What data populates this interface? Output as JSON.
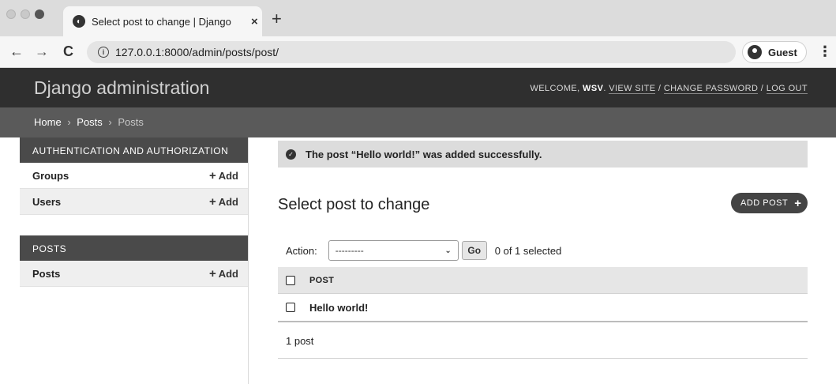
{
  "browser": {
    "tab_title": "Select post to change | Django",
    "tab_close": "×",
    "new_tab": "+",
    "back": "←",
    "forward": "→",
    "reload": "C",
    "info": "i",
    "url": "127.0.0.1:8000/admin/posts/post/",
    "profile_label": "Guest",
    "menu": "⋮"
  },
  "header": {
    "brand": "Django administration",
    "welcome": "WELCOME,",
    "username": "WSV",
    "view_site": "VIEW SITE",
    "change_password": "CHANGE PASSWORD",
    "log_out": "LOG OUT",
    "sep": " / "
  },
  "breadcrumbs": {
    "home": "Home",
    "app": "Posts",
    "current": "Posts",
    "separator": "›"
  },
  "sidebar": {
    "modules": [
      {
        "caption": "Authentication and Authorization",
        "models": [
          {
            "name": "Groups",
            "add": "Add"
          },
          {
            "name": "Users",
            "add": "Add"
          }
        ]
      },
      {
        "caption": "Posts",
        "models": [
          {
            "name": "Posts",
            "add": "Add"
          }
        ]
      }
    ]
  },
  "message": "The post “Hello world!” was added successfully.",
  "content": {
    "title": "Select post to change",
    "add_button": "ADD POST",
    "action_label": "Action:",
    "action_select_value": "---------",
    "go_button": "Go",
    "selected_count": "0 of 1 selected",
    "column_header": "POST",
    "rows": [
      "Hello world!"
    ],
    "paginator": "1 post"
  }
}
